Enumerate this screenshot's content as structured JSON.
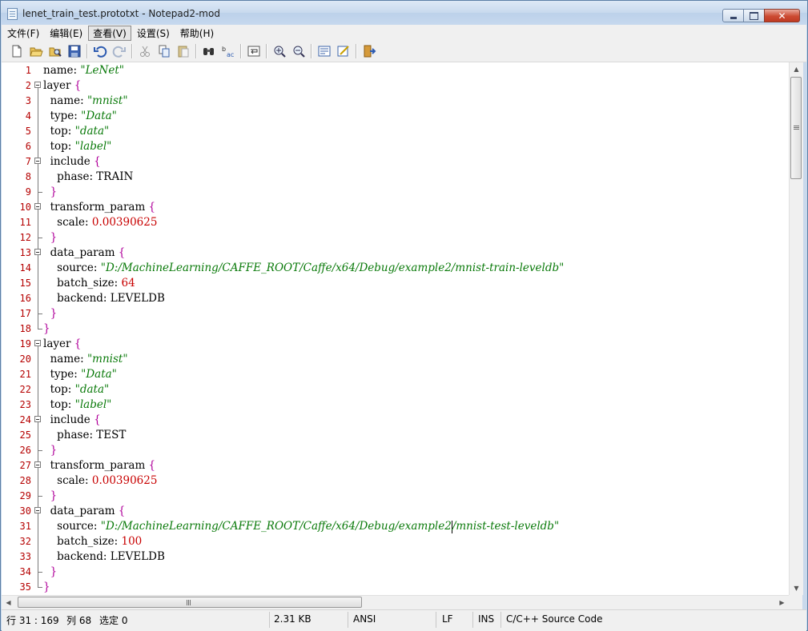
{
  "window": {
    "title": "lenet_train_test.prototxt - Notepad2-mod"
  },
  "menu": [
    {
      "label": "文件(F)"
    },
    {
      "label": "编辑(E)"
    },
    {
      "label": "查看(V)"
    },
    {
      "label": "设置(S)"
    },
    {
      "label": "帮助(H)"
    }
  ],
  "toolbar_icons": [
    "new-file-icon",
    "open-folder-icon",
    "browse-icon",
    "save-icon",
    "undo-icon",
    "redo-icon",
    "cut-icon",
    "copy-icon",
    "paste-icon",
    "find-icon",
    "replace-icon",
    "word-wrap-icon",
    "zoom-in-icon",
    "zoom-out-icon",
    "scheme-icon",
    "customize-scheme-icon",
    "exit-icon"
  ],
  "editor": {
    "lines": [
      [
        [
          "k",
          "name: "
        ],
        [
          "s",
          "\"LeNet\""
        ]
      ],
      [
        [
          "k",
          "layer "
        ],
        [
          "b",
          "{"
        ]
      ],
      [
        [
          "k",
          "  name: "
        ],
        [
          "s",
          "\"mnist\""
        ]
      ],
      [
        [
          "k",
          "  type: "
        ],
        [
          "s",
          "\"Data\""
        ]
      ],
      [
        [
          "k",
          "  top: "
        ],
        [
          "s",
          "\"data\""
        ]
      ],
      [
        [
          "k",
          "  top: "
        ],
        [
          "s",
          "\"label\""
        ]
      ],
      [
        [
          "k",
          "  include "
        ],
        [
          "b",
          "{"
        ]
      ],
      [
        [
          "k",
          "    phase: TRAIN"
        ]
      ],
      [
        [
          "b",
          "  }"
        ]
      ],
      [
        [
          "k",
          "  transform_param "
        ],
        [
          "b",
          "{"
        ]
      ],
      [
        [
          "k",
          "    scale: "
        ],
        [
          "n",
          "0.00390625"
        ]
      ],
      [
        [
          "b",
          "  }"
        ]
      ],
      [
        [
          "k",
          "  data_param "
        ],
        [
          "b",
          "{"
        ]
      ],
      [
        [
          "k",
          "    source: "
        ],
        [
          "s",
          "\"D:/MachineLearning/CAFFE_ROOT/Caffe/x64/Debug/example2/mnist-train-leveldb\""
        ]
      ],
      [
        [
          "k",
          "    batch_size: "
        ],
        [
          "n",
          "64"
        ]
      ],
      [
        [
          "k",
          "    backend: LEVELDB"
        ]
      ],
      [
        [
          "b",
          "  }"
        ]
      ],
      [
        [
          "b",
          "}"
        ]
      ],
      [
        [
          "k",
          "layer "
        ],
        [
          "b",
          "{"
        ]
      ],
      [
        [
          "k",
          "  name: "
        ],
        [
          "s",
          "\"mnist\""
        ]
      ],
      [
        [
          "k",
          "  type: "
        ],
        [
          "s",
          "\"Data\""
        ]
      ],
      [
        [
          "k",
          "  top: "
        ],
        [
          "s",
          "\"data\""
        ]
      ],
      [
        [
          "k",
          "  top: "
        ],
        [
          "s",
          "\"label\""
        ]
      ],
      [
        [
          "k",
          "  include "
        ],
        [
          "b",
          "{"
        ]
      ],
      [
        [
          "k",
          "    phase: TEST"
        ]
      ],
      [
        [
          "b",
          "  }"
        ]
      ],
      [
        [
          "k",
          "  transform_param "
        ],
        [
          "b",
          "{"
        ]
      ],
      [
        [
          "k",
          "    scale: "
        ],
        [
          "n",
          "0.00390625"
        ]
      ],
      [
        [
          "b",
          "  }"
        ]
      ],
      [
        [
          "k",
          "  data_param "
        ],
        [
          "b",
          "{"
        ]
      ],
      [
        [
          "k",
          "    source: "
        ],
        [
          "s",
          "\"D:/MachineLearning/CAFFE_ROOT/Caffe/x64/Debug/example2"
        ],
        [
          "caret",
          ""
        ],
        [
          "s",
          "/mnist-test-leveldb\""
        ]
      ],
      [
        [
          "k",
          "    batch_size: "
        ],
        [
          "n",
          "100"
        ]
      ],
      [
        [
          "k",
          "    backend: LEVELDB"
        ]
      ],
      [
        [
          "b",
          "  }"
        ]
      ],
      [
        [
          "b",
          "}"
        ]
      ]
    ],
    "folds": [
      "",
      "open",
      "mid",
      "mid",
      "mid",
      "mid",
      "open",
      "mid",
      "end",
      "open",
      "mid",
      "end",
      "open",
      "mid",
      "mid",
      "mid",
      "end",
      "endroot",
      "open",
      "mid",
      "mid",
      "mid",
      "mid",
      "open",
      "mid",
      "end",
      "open",
      "mid",
      "end",
      "open",
      "mid",
      "mid",
      "mid",
      "end",
      "endroot"
    ]
  },
  "status": {
    "position": "行 31 : 169",
    "column": "列 68",
    "selection": "选定 0",
    "size": "2.31 KB",
    "encoding": "ANSI",
    "line_ending": "LF",
    "mode": "INS",
    "lexer": "C/C++ Source Code"
  }
}
